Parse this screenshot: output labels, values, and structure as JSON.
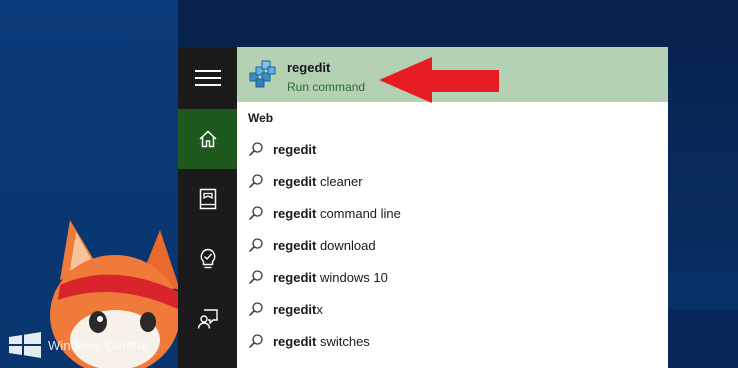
{
  "watermark": {
    "text": "Windows Central"
  },
  "rail": {
    "items": [
      {
        "name": "menu",
        "icon": "hamburger-menu-icon"
      },
      {
        "name": "home",
        "icon": "home-icon"
      },
      {
        "name": "notebook",
        "icon": "notebook-icon"
      },
      {
        "name": "reminders",
        "icon": "lightbulb-check-icon"
      },
      {
        "name": "feedback",
        "icon": "feedback-icon"
      }
    ],
    "active_color": "#1e5a1e"
  },
  "best_match": {
    "title": "regedit",
    "subtitle": "Run command",
    "highlight_color": "#b4d1b4"
  },
  "web_section": {
    "label": "Web",
    "suggestions": [
      {
        "bold": "regedit",
        "rest": ""
      },
      {
        "bold": "regedit",
        "rest": " cleaner"
      },
      {
        "bold": "regedit",
        "rest": " command line"
      },
      {
        "bold": "regedit",
        "rest": " download"
      },
      {
        "bold": "regedit",
        "rest": " windows 10"
      },
      {
        "bold": "regedit",
        "rest": "x"
      },
      {
        "bold": "regedit",
        "rest": " switches"
      }
    ]
  },
  "annotation": {
    "arrow_color": "#e81c23"
  }
}
